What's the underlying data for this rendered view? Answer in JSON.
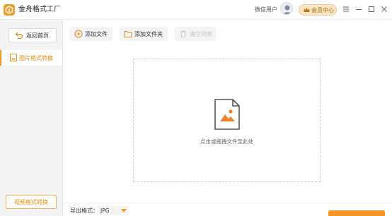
{
  "app": {
    "title": "金舟格式工厂",
    "logo_icon": "jinzhou-logo-icon",
    "accent_color": "#f39a1c"
  },
  "titlebar": {
    "user_name": "微信用户",
    "vip_label": "会员中心",
    "controls": [
      "menu-icon",
      "minimize-icon",
      "maximize-icon",
      "close-icon"
    ]
  },
  "sidebar": {
    "back_label": "返回首页",
    "items": [
      {
        "label": "图片格式转换",
        "icon": "image-doc-icon",
        "active": true
      }
    ],
    "video_label": "视频格式转换"
  },
  "toolbar": {
    "add_file_label": "添加文件",
    "add_folder_label": "添加文件夹",
    "clear_label": "清空列表"
  },
  "dropzone": {
    "hint": "点击或拖拽文件至此处"
  },
  "bottom": {
    "format_label": "导出格式：",
    "format_value": "JPG"
  }
}
